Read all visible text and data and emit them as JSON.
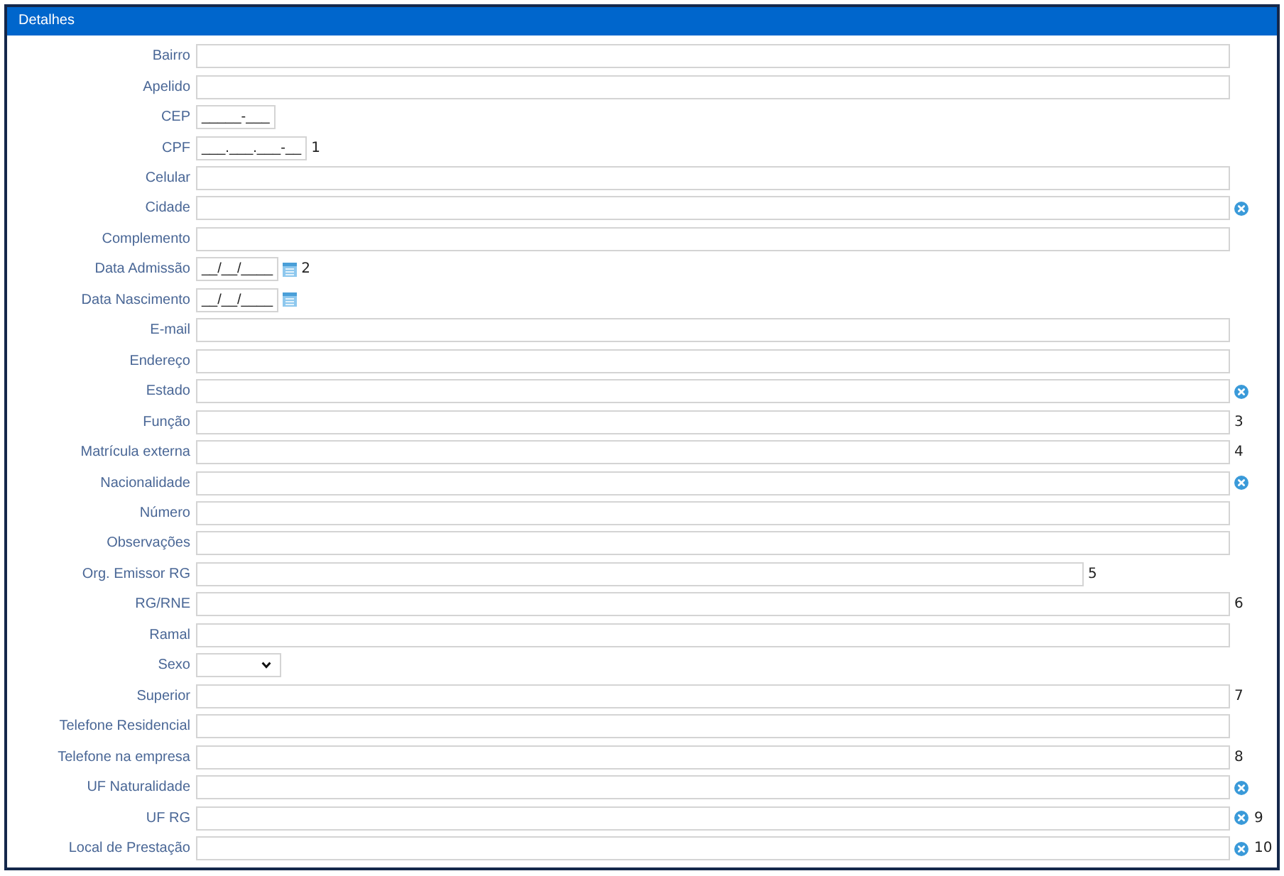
{
  "panel": {
    "title": "Detalhes"
  },
  "fields": [
    {
      "label": "Bairro",
      "kind": "text"
    },
    {
      "label": "Apelido",
      "kind": "text"
    },
    {
      "label": "CEP",
      "kind": "masked",
      "value": "_____-___"
    },
    {
      "label": "CPF",
      "kind": "masked",
      "value": "___.___.___-__",
      "note": "1"
    },
    {
      "label": "Celular",
      "kind": "text"
    },
    {
      "label": "Cidade",
      "kind": "lookup"
    },
    {
      "label": "Complemento",
      "kind": "text"
    },
    {
      "label": "Data Admissão",
      "kind": "date",
      "value": "__/__/____",
      "note": "2"
    },
    {
      "label": "Data Nascimento",
      "kind": "date",
      "value": "__/__/____"
    },
    {
      "label": "E-mail",
      "kind": "text"
    },
    {
      "label": "Endereço",
      "kind": "text"
    },
    {
      "label": "Estado",
      "kind": "lookup"
    },
    {
      "label": "Função",
      "kind": "text",
      "note": "3"
    },
    {
      "label": "Matrícula externa",
      "kind": "text",
      "note": "4"
    },
    {
      "label": "Nacionalidade",
      "kind": "lookup"
    },
    {
      "label": "Número",
      "kind": "text"
    },
    {
      "label": "Observações",
      "kind": "text"
    },
    {
      "label": "Org. Emissor RG",
      "kind": "narrow",
      "note": "5"
    },
    {
      "label": "RG/RNE",
      "kind": "text",
      "note": "6"
    },
    {
      "label": "Ramal",
      "kind": "text"
    },
    {
      "label": "Sexo",
      "kind": "select"
    },
    {
      "label": "Superior",
      "kind": "text",
      "note": "7"
    },
    {
      "label": "Telefone Residencial",
      "kind": "text"
    },
    {
      "label": "Telefone na empresa",
      "kind": "text",
      "note": "8"
    },
    {
      "label": "UF Naturalidade",
      "kind": "lookup"
    },
    {
      "label": "UF RG",
      "kind": "lookup",
      "note": "9"
    },
    {
      "label": "Local de Prestação",
      "kind": "lookup",
      "note": "10"
    }
  ]
}
